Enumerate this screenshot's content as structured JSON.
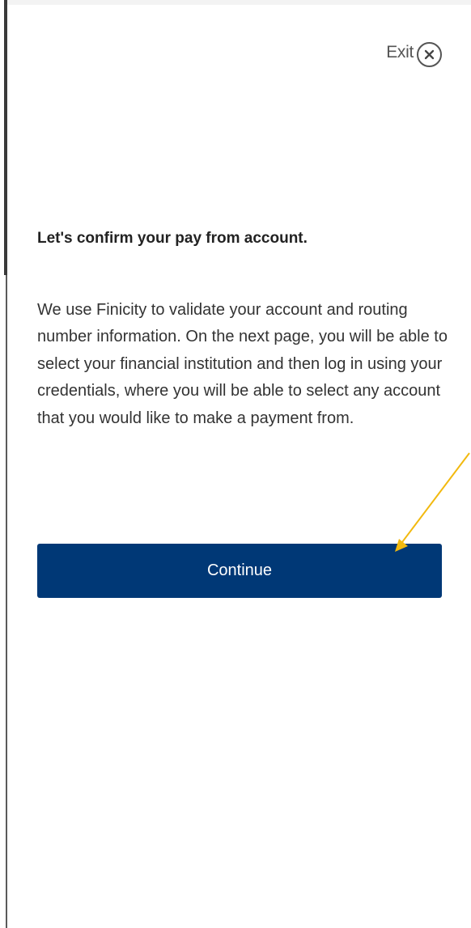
{
  "header": {
    "exit_label": "Exit",
    "exit_icon": "close-icon"
  },
  "main": {
    "heading": "Let's confirm your pay from account.",
    "body": "We use Finicity to validate your account and routing number information. On the next page, you will be able to select your financial institution and then log in using your credentials, where you will be able to select any account that you would like to make a payment from.",
    "continue_label": "Continue"
  },
  "colors": {
    "primary_button": "#003876",
    "annotation_arrow": "#f2b90f",
    "text": "#333333"
  }
}
